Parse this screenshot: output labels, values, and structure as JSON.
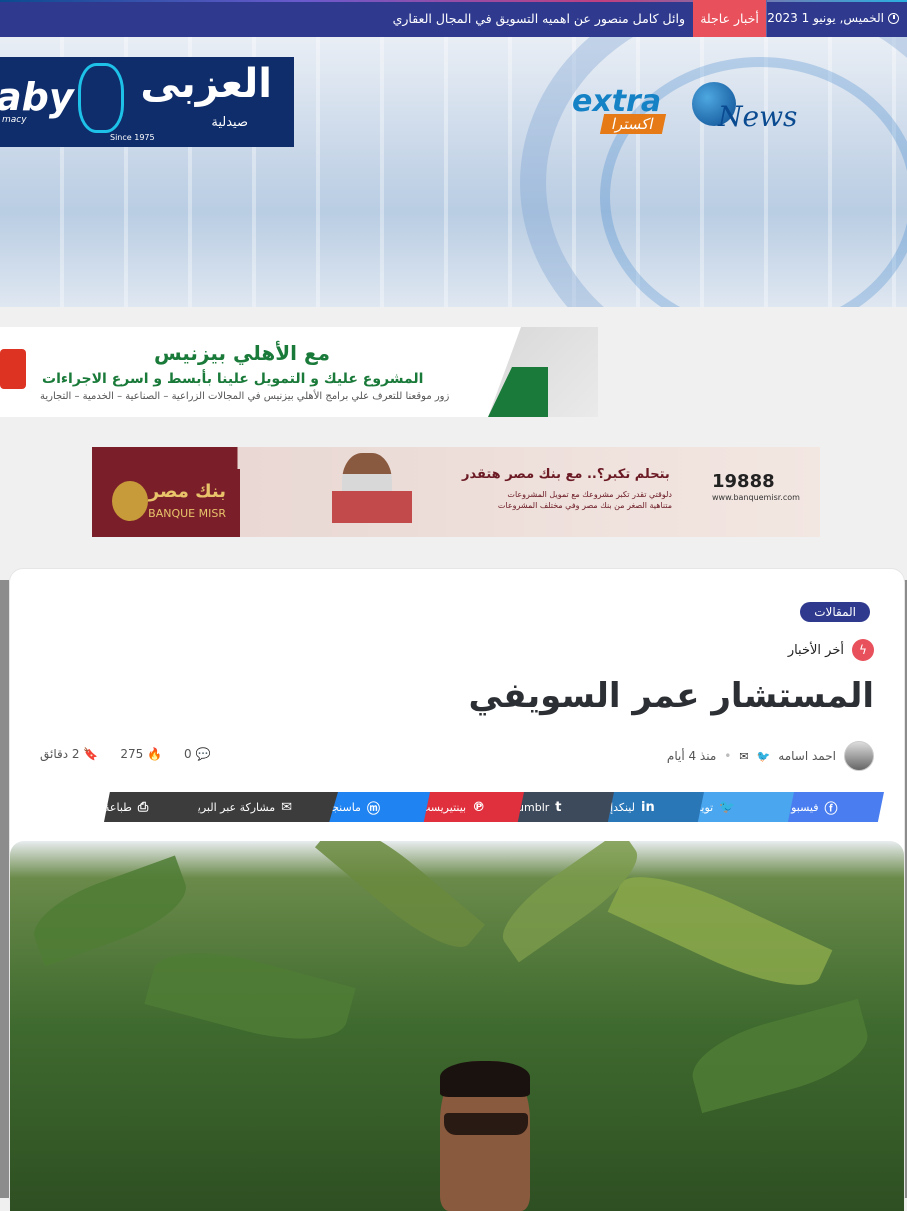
{
  "topbar": {
    "date": "الخميس, يونيو 1 2023",
    "breaking_label": "أخبار عاجلة",
    "ticker_text": "وائل كامل منصور عن اهميه التسويق في المجال العقاري"
  },
  "header": {
    "sponsor_ar": "العزبى",
    "sponsor_en": "aby",
    "sponsor_sub": "صيدلية",
    "sponsor_since": "Since 1975",
    "sponsor_macy": "macy",
    "logo_extra": "extra",
    "logo_badge": "اكسترا",
    "logo_news": "News"
  },
  "ads": {
    "ahli_title": "مع الأهلي بيزنيس",
    "ahli_line1": "المشروع عليك و التمويل علينا بأبسط و اسرع الاجراءات",
    "ahli_line2": "زور موقعنا للتعرف علي برامج الأهلي بيزنيس في المجالات الزراعية – الصناعية – الخدمية – التجارية",
    "misr_number": "19888",
    "misr_url": "www.banquemisr.com",
    "misr_headline": "بتحلم تكبر؟.. مع بنك مصر هتقدر",
    "misr_body": "دلوقتي تقدر تكبر مشروعك مع تمويل المشروعات متناهية الصغر من بنك مصر وفي مختلف المشروعات",
    "misr_logo_ar": "بنك مصر",
    "misr_logo_en": "BANQUE MISR"
  },
  "article": {
    "category": "المقالات",
    "latest_label": "أخر الأخبار",
    "title": "المستشار عمر السويفي",
    "author": "احمد اسامه",
    "time_ago": "منذ 4 أيام",
    "comments": "0",
    "views": "275",
    "read_time": "2 دقائق"
  },
  "share": [
    {
      "label": "فيسبوك",
      "glyph": "f",
      "color": "#4a7ef0"
    },
    {
      "label": "تويتر",
      "glyph": "t",
      "color": "#4aa6ef"
    },
    {
      "label": "لينكدإن",
      "glyph": "in",
      "color": "#2a77b8"
    },
    {
      "label": "Tumblr",
      "glyph": "t",
      "color": "#3d4a5c"
    },
    {
      "label": "بينتيريست",
      "glyph": "p",
      "color": "#e0303e"
    },
    {
      "label": "ماسنجر",
      "glyph": "m",
      "color": "#1f83f2"
    },
    {
      "label": "مشاركة عبر البريد",
      "glyph": "✉",
      "color": "#3c3c3c"
    },
    {
      "label": "طباعة",
      "glyph": "⎙",
      "color": "#3c3c3c"
    }
  ],
  "icons": {
    "clock": "clock-icon",
    "bolt": "bolt-icon",
    "comment": "comment-icon",
    "fire": "fire-icon",
    "bookmark": "bookmark-icon",
    "mail": "mail-icon",
    "twitter": "twitter-icon"
  },
  "colors": {
    "topbar": "#2f3a8f",
    "breaking": "#e8505b",
    "accent": "#2f3a8f"
  }
}
